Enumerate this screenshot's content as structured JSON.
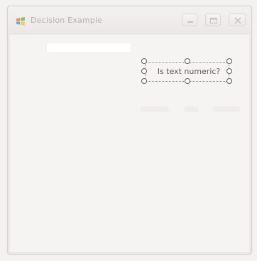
{
  "window": {
    "title": "Decision Example",
    "icon": "app-windows-icon",
    "buttons": {
      "minimize": "minimize-icon",
      "maximize": "maximize-icon",
      "close": "close-icon"
    }
  },
  "form": {
    "label_text": "Is text numeric?",
    "textbox_value": ""
  }
}
